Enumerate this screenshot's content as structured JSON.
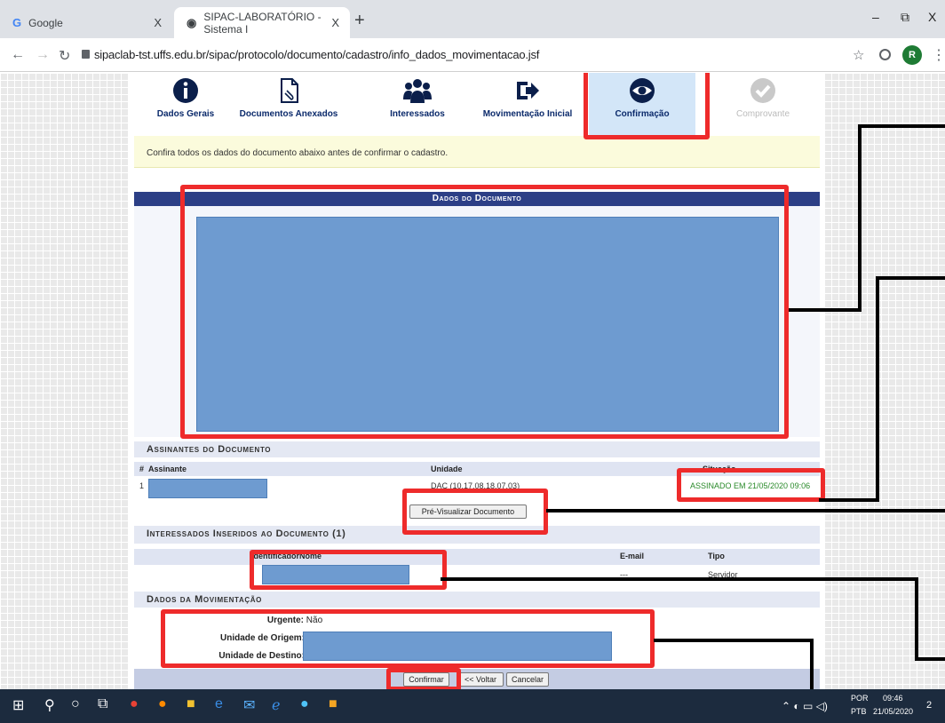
{
  "browser": {
    "tabs": [
      {
        "icon": "G",
        "label": "Google",
        "close": "X"
      },
      {
        "icon": "◉",
        "label": "SIPAC-LABORATÓRIO - Sistema I",
        "close": "X"
      }
    ],
    "new_tab": "+",
    "window_controls": {
      "minimize": "–",
      "restore": "⧉",
      "close": "X"
    },
    "url": "sipaclab-tst.uffs.edu.br/sipac/protocolo/documento/cadastro/info_dados_movimentacao.jsf",
    "profile_initial": "R"
  },
  "wizard": {
    "steps": [
      {
        "label": "Dados Gerais",
        "icon": "info-icon"
      },
      {
        "label": "Documentos Anexados",
        "icon": "document-icon"
      },
      {
        "label": "Interessados",
        "icon": "people-icon"
      },
      {
        "label": "Movimentação Inicial",
        "icon": "exit-icon"
      },
      {
        "label": "Confirmação",
        "icon": "eye-icon"
      },
      {
        "label": "Comprovante",
        "icon": "check-icon"
      }
    ],
    "current_step": "Confirmação"
  },
  "notice": "Confira todos os dados do documento abaixo antes de confirmar o cadastro.",
  "dados_documento": {
    "title": "Dados do Documento"
  },
  "assinantes": {
    "title": "Assinantes do Documento",
    "headers": {
      "num": "#",
      "assinante": "Assinante",
      "unidade": "Unidade",
      "situacao": "Situação"
    },
    "rows": [
      {
        "num": "1",
        "unidade": "DAC (10.17.08.18.07.03)",
        "situacao": "ASSINADO EM 21/05/2020 09:06"
      }
    ],
    "preview_button": "Pré-Visualizar Documento"
  },
  "interessados": {
    "title": "Interessados Inseridos ao Documento (1)",
    "headers": {
      "identificador": "Identificador",
      "nome": "Nome",
      "email": "E-mail",
      "tipo": "Tipo"
    },
    "rows": [
      {
        "email": "---",
        "tipo": "Servidor"
      }
    ]
  },
  "movimentacao": {
    "title": "Dados da Movimentação",
    "urgente_label": "Urgente:",
    "urgente_value": "Não",
    "origem_label": "Unidade de Origem:",
    "destino_label": "Unidade de Destino:"
  },
  "buttons": {
    "confirmar": "Confirmar",
    "voltar": "<< Voltar",
    "cancelar": "Cancelar"
  },
  "colors": {
    "annotation": "#ee2b2b",
    "redaction": "#6e9bd0",
    "section_header": "#2c3f86",
    "signed_status": "#2a8a2a"
  },
  "taskbar": {
    "lang_top": "POR",
    "lang_bottom": "PTB",
    "time": "09:46",
    "date": "21/05/2020",
    "notification_count": "2"
  }
}
